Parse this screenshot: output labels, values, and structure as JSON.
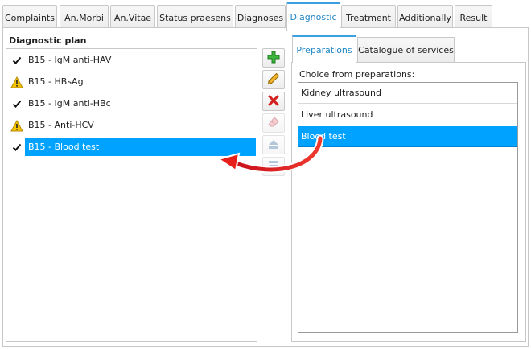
{
  "tabs": [
    {
      "label": "Complaints"
    },
    {
      "label": "An.Morbi"
    },
    {
      "label": "An.Vitae"
    },
    {
      "label": "Status praesens"
    },
    {
      "label": "Diagnoses"
    },
    {
      "label": "Diagnostic"
    },
    {
      "label": "Treatment"
    },
    {
      "label": "Additionally"
    },
    {
      "label": "Result"
    }
  ],
  "active_tab": "Diagnostic",
  "plan": {
    "title": "Diagnostic plan",
    "items": [
      {
        "label": "B15 - IgM anti-HAV",
        "icon": "checkmark-icon"
      },
      {
        "label": "B15 - HBsAg",
        "icon": "warning-icon"
      },
      {
        "label": "B15 - IgM anti-HBc",
        "icon": "checkmark-icon"
      },
      {
        "label": "B15 - Anti-HCV",
        "icon": "warning-icon"
      },
      {
        "label": "B15 - Blood test",
        "icon": "checkmark-icon",
        "selected": true
      }
    ]
  },
  "toolbar": {
    "buttons": [
      {
        "icon": "add-icon"
      },
      {
        "icon": "edit-icon"
      },
      {
        "icon": "delete-icon"
      },
      {
        "icon": "eraser-icon"
      },
      {
        "icon": "move-up-icon"
      },
      {
        "icon": "move-down-icon"
      }
    ]
  },
  "right": {
    "tabs": [
      {
        "label": "Preparations"
      },
      {
        "label": "Catalogue of services"
      }
    ],
    "active_tab": "Preparations",
    "choice_label": "Choice from preparations:",
    "items": [
      {
        "label": "Kidney ultrasound"
      },
      {
        "label": "Liver ultrasound"
      },
      {
        "label": "Blood test",
        "selected": true
      }
    ]
  },
  "colors": {
    "selection": "#00a2ff",
    "active_tab_text": "#1f86c4",
    "annotation_arrow": "#e8201c"
  }
}
